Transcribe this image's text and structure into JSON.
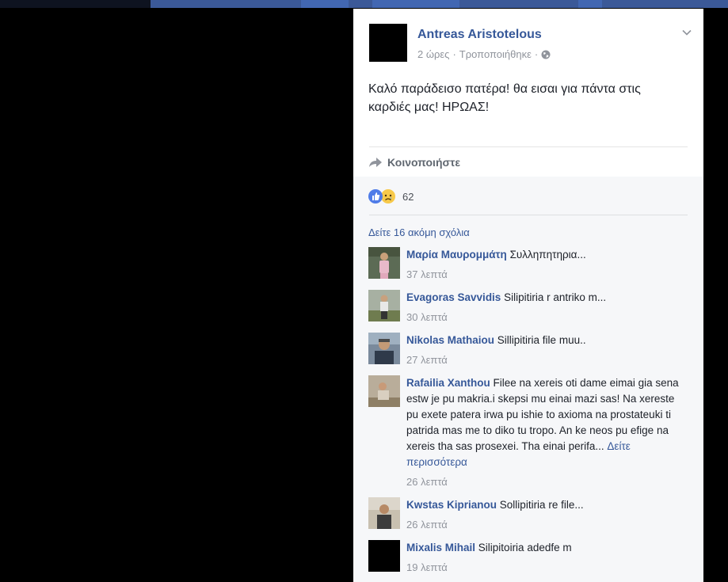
{
  "post": {
    "author": "Antreas Aristotelous",
    "time": "2 ώρες",
    "edited": "Τροποποιήθηκε",
    "separator": "·",
    "audience_icon": "globe-icon",
    "text": "Καλό παράδεισο πατέρα! θα εισαι για πάντα στις καρδιές μας! ΗΡΩΑΣ!",
    "share_label": "Κοινοποιήστε"
  },
  "reactions": {
    "types": [
      "like",
      "sad"
    ],
    "count": "62"
  },
  "comments_section": {
    "view_more": "Δείτε 16 ακόμη σχόλια",
    "comments": [
      {
        "name": "Μαρία Μαυρομμάτη",
        "text": "Συλληπητηρια...",
        "time": "37 λεπτά"
      },
      {
        "name": "Evagoras Savvidis",
        "text": "Silipitiria r antriko m...",
        "time": "30 λεπτά"
      },
      {
        "name": "Nikolas Mathaiou",
        "text": "Sillipitiria file muu..",
        "time": "27 λεπτά"
      },
      {
        "name": "Rafailia Xanthou",
        "text": "Filee na xereis oti dame eimai gia sena estw je pu makria.i skepsi mu einai mazi sas! Na xereste pu exete patera irwa pu ishie to axioma na prostateuki ti patrida mas me to diko tu tropo. An ke neos pu efige na xereis tha sas prosexei. Tha einai perifa...",
        "see_more": "Δείτε περισσότερα",
        "time": "26 λεπτά"
      },
      {
        "name": "Kwstas Kiprianou",
        "text": "Sollipitiria re file...",
        "time": "26 λεπτά"
      },
      {
        "name": "Mixalis Mihail",
        "text": "Silipitoiria adedfe m",
        "time": "19 λεπτά"
      }
    ]
  },
  "colors": {
    "link": "#365899",
    "topbar": "#3b5998",
    "background": "#000000"
  }
}
